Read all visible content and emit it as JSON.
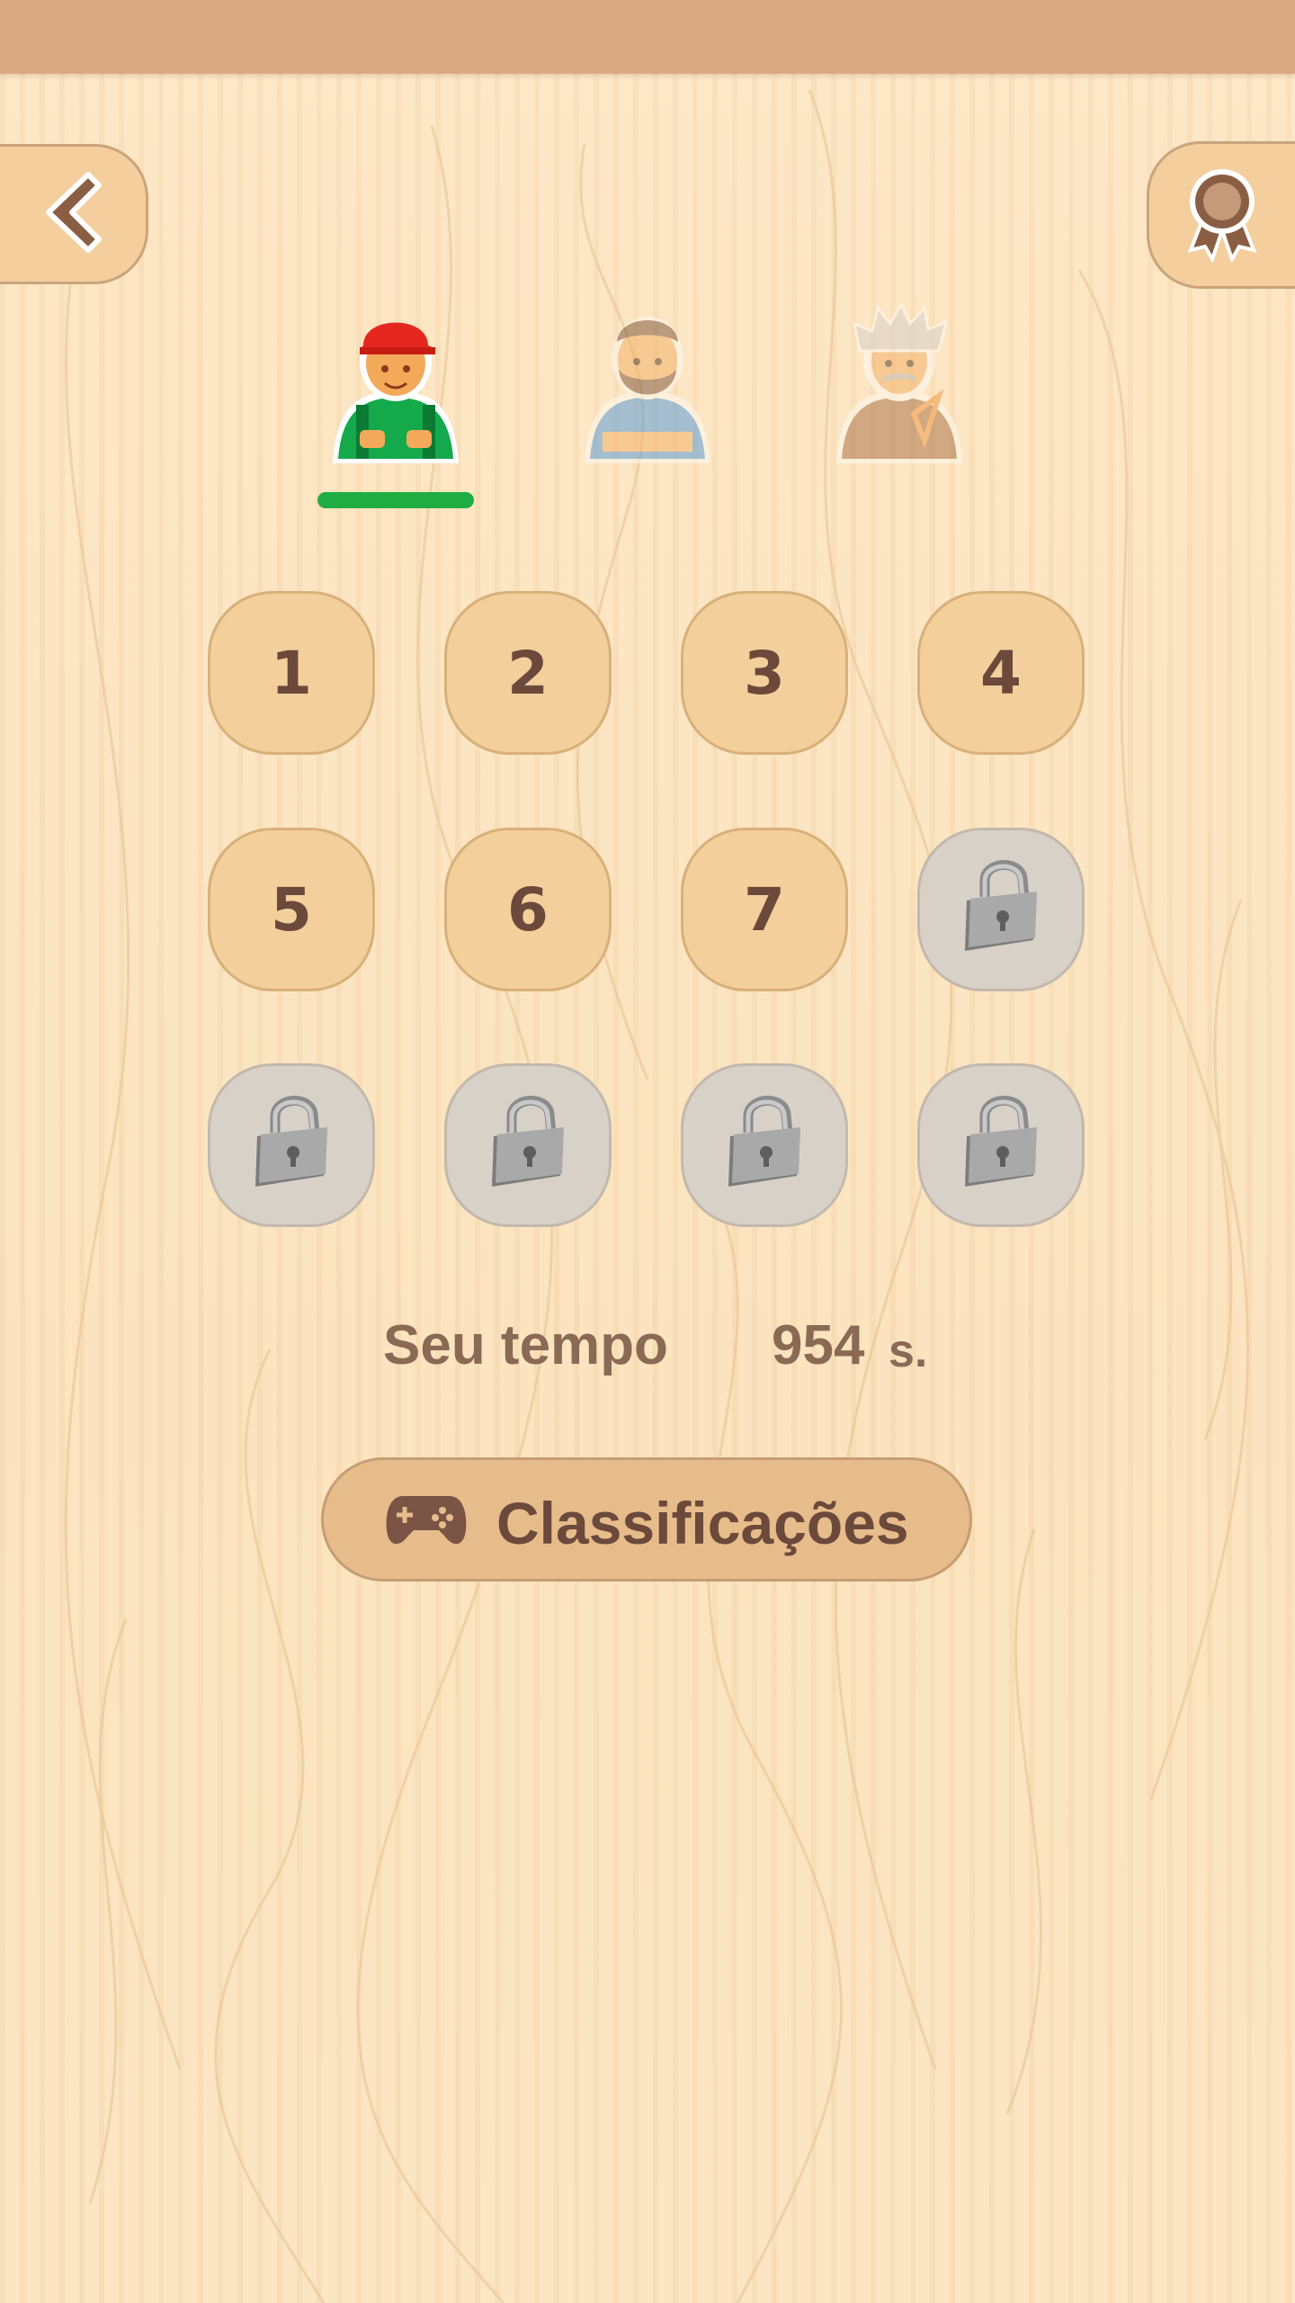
{
  "topbar": {
    "color": "#d9a983"
  },
  "nav": {
    "back_icon": "chevron-left-icon",
    "award_icon": "award-ribbon-icon"
  },
  "characters": {
    "selected_index": 0,
    "items": [
      {
        "name": "worker-avatar",
        "selected": true
      },
      {
        "name": "bearded-man-avatar",
        "selected": false
      },
      {
        "name": "scientist-avatar",
        "selected": false
      }
    ],
    "underline_color": "#1fad43"
  },
  "levels": [
    {
      "label": "1",
      "locked": false
    },
    {
      "label": "2",
      "locked": false
    },
    {
      "label": "3",
      "locked": false
    },
    {
      "label": "4",
      "locked": false
    },
    {
      "label": "5",
      "locked": false
    },
    {
      "label": "6",
      "locked": false
    },
    {
      "label": "7",
      "locked": false
    },
    {
      "label": "",
      "locked": true
    },
    {
      "label": "",
      "locked": true
    },
    {
      "label": "",
      "locked": true
    },
    {
      "label": "",
      "locked": true
    },
    {
      "label": "",
      "locked": true
    }
  ],
  "time": {
    "label": "Seu tempo",
    "value": "954",
    "unit": "s."
  },
  "ranking_button": {
    "label": "Classificações",
    "icon": "gamepad-icon"
  }
}
